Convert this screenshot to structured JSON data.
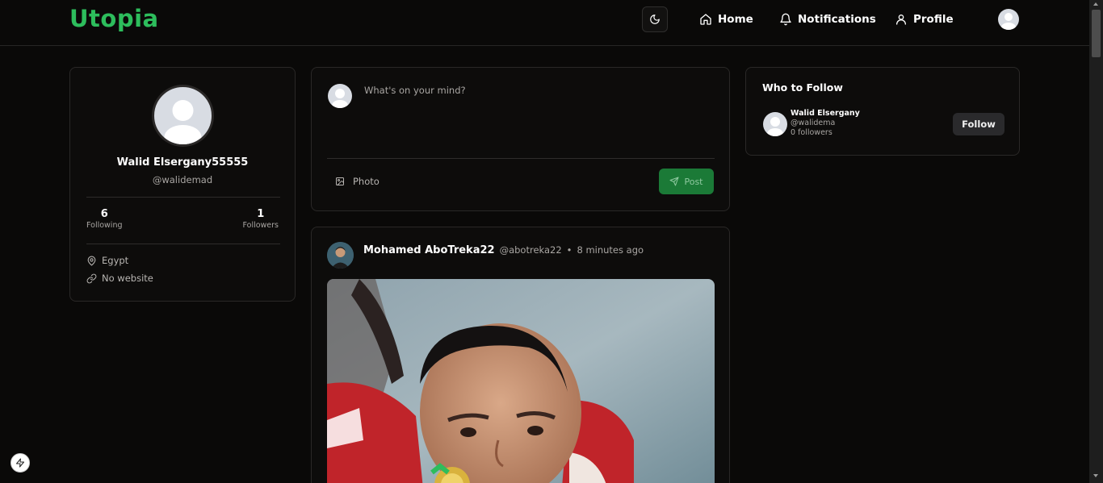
{
  "app": {
    "name": "Utopia",
    "brand_color": "#2dbd5c"
  },
  "nav": {
    "theme_icon": "moon-icon",
    "home_label": "Home",
    "notifications_label": "Notifications",
    "profile_label": "Profile"
  },
  "profile": {
    "name": "Walid Elsergany55555",
    "handle": "@walidemad",
    "following_count": "6",
    "following_label": "Following",
    "followers_count": "1",
    "followers_label": "Followers",
    "location": "Egypt",
    "website": "No website"
  },
  "composer": {
    "placeholder": "What's on your mind?",
    "photo_label": "Photo",
    "post_label": "Post"
  },
  "post": {
    "author": "Mohamed AboTreka22",
    "handle": "@abotreka22",
    "separator": "•",
    "time": "8 minutes ago"
  },
  "who_to_follow": {
    "title": "Who to Follow",
    "users": [
      {
        "name": "Walid Elsergany",
        "handle": "@walidema",
        "followers": "0 followers",
        "button_label": "Follow"
      }
    ]
  }
}
